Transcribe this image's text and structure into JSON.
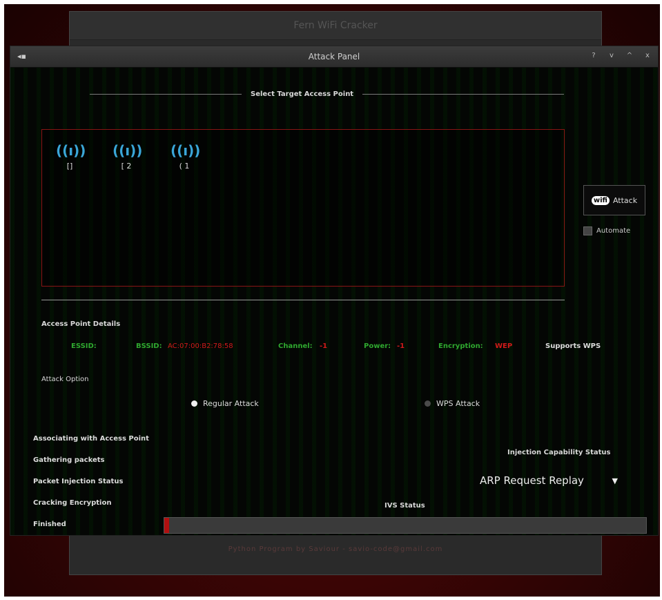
{
  "background_window": {
    "title": "Fern WiFi Cracker",
    "bottom_text": "Python Program by Saviour - savio-code@gmail.com"
  },
  "window": {
    "title": "Attack Panel",
    "controls": [
      "?",
      "v",
      "^",
      "x"
    ]
  },
  "target_section": {
    "label": "Select Target Access Point",
    "access_points": [
      {
        "label": "[]"
      },
      {
        "label": "[ 2"
      },
      {
        "label": "( 1"
      }
    ]
  },
  "attack_button": {
    "logo": "wifi",
    "label": "Attack"
  },
  "automate": {
    "label": "Automate",
    "checked": false
  },
  "details": {
    "heading": "Access Point Details",
    "essid_label": "ESSID:",
    "bssid_label": "BSSID:",
    "bssid_value": "AC:07:00:B2:78:58",
    "channel_label": "Channel:",
    "channel_value": "-1",
    "power_label": "Power:",
    "power_value": "-1",
    "encryption_label": "Encryption:",
    "encryption_value": "WEP",
    "wps_label": "Supports WPS"
  },
  "attack_option": {
    "heading": "Attack Option",
    "regular": "Regular Attack",
    "wps": "WPS Attack",
    "selected": "regular"
  },
  "status": {
    "associating": "Associating with Access Point",
    "gathering": "Gathering packets",
    "injection": "Packet Injection Status",
    "cracking": "Cracking Encryption",
    "finished": "Finished"
  },
  "injection_capability": "Injection Capability Status",
  "attack_type": {
    "selected": "ARP Request Replay"
  },
  "ivs_status": "IVS Status",
  "progress": 0.01,
  "colors": {
    "green": "#2fa82f",
    "red": "#d01a1a",
    "accent_blue": "#3aa6d8",
    "frame_red": "#8a1515"
  }
}
